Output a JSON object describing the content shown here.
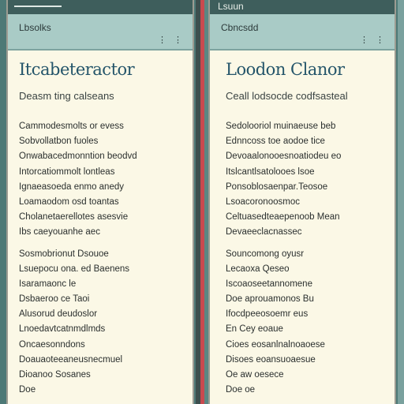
{
  "left_panel": {
    "topbar_title": "",
    "app_title": "Lbsolks",
    "app_icons": "⋮ ⋮",
    "heading": "Itcabeteractor",
    "subheading": "Deasm ting calseans",
    "paragraphs": [
      [
        "Cammodesmolts or evess",
        "Sobvollatbon fuoles",
        "Onwabacedmonntion beodvd",
        "Intorcatiommolt lontleas",
        "Ignaeasoeda enmo anedy",
        "Loamaodom osd toantas",
        "Cholanetaerellotes asesvie",
        "Ibs caeyouanhe aec"
      ],
      [
        "Sosmobrionut Dsouoe",
        "Lsuepocu ona. ed Baenens",
        "Isaramaonc le",
        "Dsbaeroo          ce Taoi",
        "Alusorud deudoslor",
        "Lnoedavtcatnmdlmds",
        "Oncaesonndons",
        "Doauaoteeaneusnecmuel",
        "Dioanoo Sosanes",
        "Doe"
      ]
    ]
  },
  "right_panel": {
    "topbar_title": "Lsuun",
    "app_title": "Cbncsdd",
    "app_icons": "⋮ ⋮",
    "heading": "Loodon Clanor",
    "subheading": "Ceall lodsocde codfsasteal",
    "paragraphs": [
      [
        "Sedolooriol muinaeuse beb",
        "Ednncoss toe aodoe tice",
        "Devoaalonooesnoatiodeu eo",
        "Itslcantlsatolooes lsoe",
        "Ponsoblosaenpar.Teosoe",
        "Lsoacoronoosmoc",
        "Celtuasedteaepenoob Mean",
        "Devaeeclacnassec"
      ],
      [
        "Souncomong oyusr",
        "Lecaoxa Qeseo",
        "Iscoaoseetannomene",
        "Doe aprouamonos Bu",
        "Ifocdpeeosoemr eus",
        "En Cey eoaue",
        "Cioes eosanlnalnoaoese",
        "Disoes eoansuoaesue",
        "Oe aw oesece",
        "Doe oe"
      ]
    ]
  }
}
